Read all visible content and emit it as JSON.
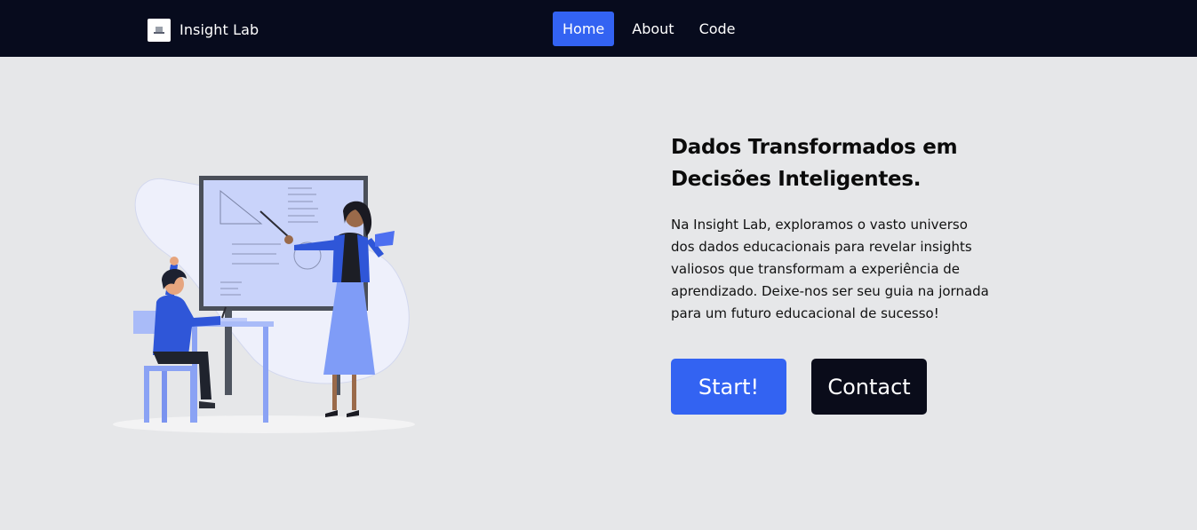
{
  "navbar": {
    "brand": "Insight Lab",
    "logo_icon": "insight-lab-logo-icon",
    "links": [
      {
        "label": "Home",
        "active": true
      },
      {
        "label": "About",
        "active": false
      },
      {
        "label": "Code",
        "active": false
      }
    ]
  },
  "hero": {
    "headline_line1": "Dados Transformados em",
    "headline_line2": "Decisões Inteligentes.",
    "paragraph": "Na Insight Lab, exploramos o vasto universo dos dados educacionais para revelar insights valiosos que transformam a experiência de aprendizado. Deixe-nos ser seu guia na jornada para um futuro educacional de sucesso!",
    "start_label": "Start!",
    "contact_label": "Contact",
    "illustration_icon": "teacher-classroom-illustration"
  },
  "colors": {
    "navbar_bg": "#070b1d",
    "page_bg": "#e6e7e9",
    "accent": "#3363f2",
    "contact_bg": "#0a0c1a"
  }
}
